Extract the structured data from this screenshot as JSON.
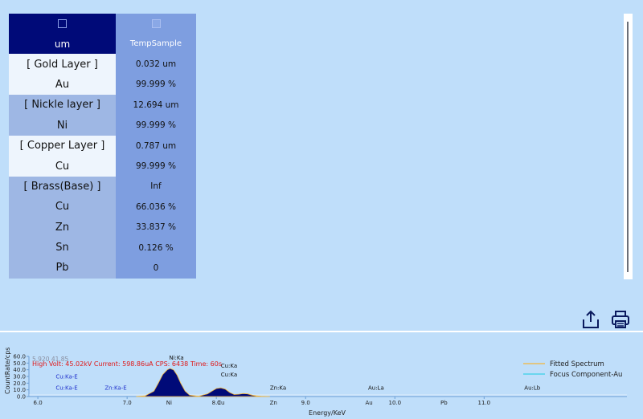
{
  "table": {
    "col1_header": "um",
    "col2_header": "TempSample",
    "rows": [
      {
        "name": "[ Gold Layer ]",
        "value": "0.032 um",
        "style": "light"
      },
      {
        "name": "Au",
        "value": "99.999 %",
        "style": "light"
      },
      {
        "name": "[ Nickle layer ]",
        "value": "12.694 um",
        "style": "mid"
      },
      {
        "name": "Ni",
        "value": "99.999 %",
        "style": "mid"
      },
      {
        "name": "[ Copper Layer ]",
        "value": "0.787 um",
        "style": "light"
      },
      {
        "name": "Cu",
        "value": "99.999 %",
        "style": "light"
      },
      {
        "name": "[ Brass(Base) ]",
        "value": "Inf",
        "style": "mid"
      },
      {
        "name": "Cu",
        "value": "66.036 %",
        "style": "mid"
      },
      {
        "name": "Zn",
        "value": "33.837 %",
        "style": "mid"
      },
      {
        "name": "Sn",
        "value": "0.126 %",
        "style": "mid"
      },
      {
        "name": "Pb",
        "value": "0",
        "style": "mid"
      }
    ]
  },
  "toolbar": {
    "export_icon": "export-icon",
    "print_icon": "printer-icon"
  },
  "spectrum": {
    "status_text": "High Volt: 45.02kV  Current: 598.86uA  CPS: 6438  Time: 60s",
    "cursor_readout": "5.920  41.85",
    "legend": [
      {
        "name": "Fitted Spectrum",
        "color": "#f4b63a"
      },
      {
        "name": "Focus Component-Au",
        "color": "#38d0e6"
      }
    ]
  },
  "chart_data": {
    "type": "area",
    "xlabel": "Energy/KeV",
    "ylabel": "CountRate/cps",
    "xlim": [
      5.9,
      12.6
    ],
    "ylim": [
      0,
      60
    ],
    "x_ticks": [
      "6.0",
      "7.0",
      "8.0",
      "9.0",
      "10.0",
      "11.0"
    ],
    "x_tick_values": [
      6.0,
      7.0,
      8.0,
      9.0,
      10.0,
      11.0
    ],
    "y_ticks": [
      "0.0",
      "10.0",
      "20.0",
      "30.0",
      "40.0",
      "50.0",
      "60.0"
    ],
    "y_tick_values": [
      0,
      10,
      20,
      30,
      40,
      50,
      60
    ],
    "peak_labels": [
      {
        "text": "Ni:Ka",
        "x": 7.47,
        "y": 55,
        "color": "#111111"
      },
      {
        "text": "Cu:Ka",
        "x": 8.05,
        "y": 43,
        "color": "#111111"
      },
      {
        "text": "Cu:Ka",
        "x": 8.05,
        "y": 30,
        "color": "#111111"
      },
      {
        "text": "Cu:Ka-E",
        "x": 6.2,
        "y": 27,
        "color": "#2233cc"
      },
      {
        "text": "Cu:Ka-E",
        "x": 6.2,
        "y": 10,
        "color": "#2233cc"
      },
      {
        "text": "Zn:Ka-E",
        "x": 6.75,
        "y": 10,
        "color": "#2233cc"
      },
      {
        "text": "Zn:Ka",
        "x": 8.6,
        "y": 10,
        "color": "#111111"
      },
      {
        "text": "Au:La",
        "x": 9.7,
        "y": 10,
        "color": "#111111"
      },
      {
        "text": "Au:Lb",
        "x": 11.45,
        "y": 10,
        "color": "#111111"
      }
    ],
    "element_markers": [
      {
        "text": "Ni",
        "x": 7.47
      },
      {
        "text": "Cu",
        "x": 8.05
      },
      {
        "text": "Zn",
        "x": 8.64
      },
      {
        "text": "Au",
        "x": 9.71
      },
      {
        "text": "Pb",
        "x": 10.55
      }
    ],
    "series": [
      {
        "name": "Fitted Spectrum",
        "x": [
          7.1,
          7.2,
          7.3,
          7.35,
          7.4,
          7.45,
          7.48,
          7.52,
          7.56,
          7.6,
          7.65,
          7.7,
          7.8,
          7.9,
          7.95,
          8.0,
          8.05,
          8.1,
          8.15,
          8.2,
          8.25,
          8.3,
          8.35,
          8.4,
          8.45,
          8.5,
          8.6
        ],
        "y": [
          0,
          1,
          8,
          20,
          33,
          40,
          42,
          40,
          32,
          20,
          8,
          2,
          0.5,
          4,
          8,
          12,
          13,
          11,
          6,
          3,
          3.5,
          4.5,
          4,
          2,
          1,
          0.5,
          0
        ]
      }
    ]
  }
}
